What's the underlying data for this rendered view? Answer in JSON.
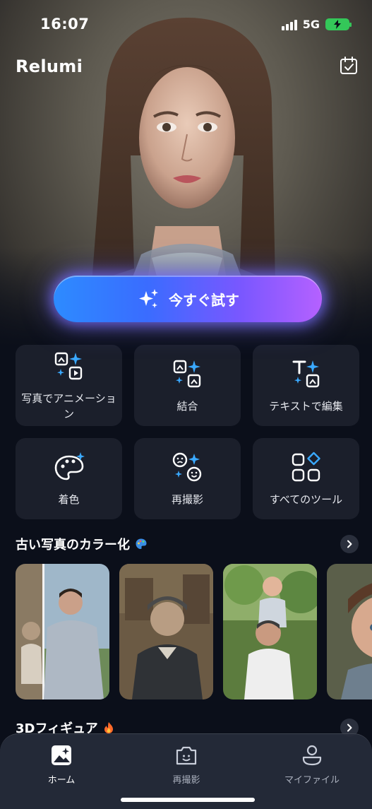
{
  "status": {
    "time": "16:07",
    "network": "5G"
  },
  "app": {
    "title": "Relumi"
  },
  "hero": {
    "cta_label": "今すぐ試す"
  },
  "tools": [
    {
      "label": "写真でアニメーション",
      "icon": "animate-photo-icon"
    },
    {
      "label": "結合",
      "icon": "merge-icon"
    },
    {
      "label": "テキストで編集",
      "icon": "text-edit-icon"
    },
    {
      "label": "着色",
      "icon": "palette-icon"
    },
    {
      "label": "再撮影",
      "icon": "retake-face-icon"
    },
    {
      "label": "すべてのツール",
      "icon": "all-tools-icon"
    }
  ],
  "sections": {
    "colorize": {
      "title": "古い写真のカラー化"
    },
    "figure": {
      "title": "3Dフィギュア"
    }
  },
  "nav": {
    "items": [
      {
        "label": "ホーム",
        "active": true
      },
      {
        "label": "再撮影",
        "active": false
      },
      {
        "label": "マイファイル",
        "active": false
      }
    ]
  },
  "colors": {
    "background": "#0b0f1a",
    "card": "#1b1f2b",
    "accent_blue": "#2d8bff",
    "accent_purple": "#b561ff",
    "sparkle": "#3aa9ff"
  }
}
